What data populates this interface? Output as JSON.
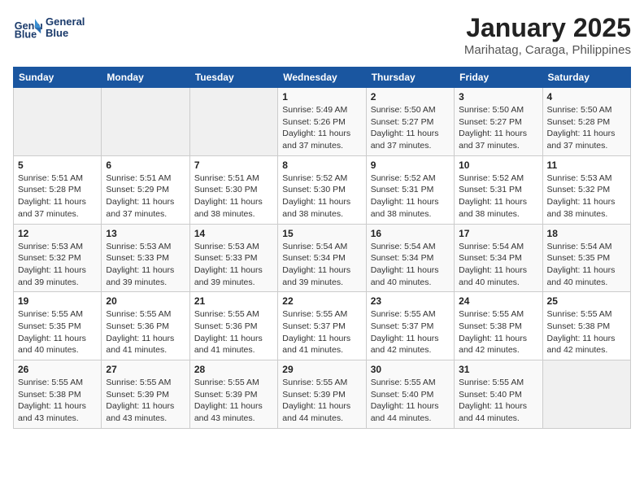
{
  "header": {
    "logo_line1": "General",
    "logo_line2": "Blue",
    "month": "January 2025",
    "location": "Marihatag, Caraga, Philippines"
  },
  "weekdays": [
    "Sunday",
    "Monday",
    "Tuesday",
    "Wednesday",
    "Thursday",
    "Friday",
    "Saturday"
  ],
  "weeks": [
    [
      {
        "day": "",
        "sunrise": "",
        "sunset": "",
        "daylight": "",
        "empty": true
      },
      {
        "day": "",
        "sunrise": "",
        "sunset": "",
        "daylight": "",
        "empty": true
      },
      {
        "day": "",
        "sunrise": "",
        "sunset": "",
        "daylight": "",
        "empty": true
      },
      {
        "day": "1",
        "sunrise": "Sunrise: 5:49 AM",
        "sunset": "Sunset: 5:26 PM",
        "daylight": "Daylight: 11 hours and 37 minutes."
      },
      {
        "day": "2",
        "sunrise": "Sunrise: 5:50 AM",
        "sunset": "Sunset: 5:27 PM",
        "daylight": "Daylight: 11 hours and 37 minutes."
      },
      {
        "day": "3",
        "sunrise": "Sunrise: 5:50 AM",
        "sunset": "Sunset: 5:27 PM",
        "daylight": "Daylight: 11 hours and 37 minutes."
      },
      {
        "day": "4",
        "sunrise": "Sunrise: 5:50 AM",
        "sunset": "Sunset: 5:28 PM",
        "daylight": "Daylight: 11 hours and 37 minutes."
      }
    ],
    [
      {
        "day": "5",
        "sunrise": "Sunrise: 5:51 AM",
        "sunset": "Sunset: 5:28 PM",
        "daylight": "Daylight: 11 hours and 37 minutes."
      },
      {
        "day": "6",
        "sunrise": "Sunrise: 5:51 AM",
        "sunset": "Sunset: 5:29 PM",
        "daylight": "Daylight: 11 hours and 37 minutes."
      },
      {
        "day": "7",
        "sunrise": "Sunrise: 5:51 AM",
        "sunset": "Sunset: 5:30 PM",
        "daylight": "Daylight: 11 hours and 38 minutes."
      },
      {
        "day": "8",
        "sunrise": "Sunrise: 5:52 AM",
        "sunset": "Sunset: 5:30 PM",
        "daylight": "Daylight: 11 hours and 38 minutes."
      },
      {
        "day": "9",
        "sunrise": "Sunrise: 5:52 AM",
        "sunset": "Sunset: 5:31 PM",
        "daylight": "Daylight: 11 hours and 38 minutes."
      },
      {
        "day": "10",
        "sunrise": "Sunrise: 5:52 AM",
        "sunset": "Sunset: 5:31 PM",
        "daylight": "Daylight: 11 hours and 38 minutes."
      },
      {
        "day": "11",
        "sunrise": "Sunrise: 5:53 AM",
        "sunset": "Sunset: 5:32 PM",
        "daylight": "Daylight: 11 hours and 38 minutes."
      }
    ],
    [
      {
        "day": "12",
        "sunrise": "Sunrise: 5:53 AM",
        "sunset": "Sunset: 5:32 PM",
        "daylight": "Daylight: 11 hours and 39 minutes."
      },
      {
        "day": "13",
        "sunrise": "Sunrise: 5:53 AM",
        "sunset": "Sunset: 5:33 PM",
        "daylight": "Daylight: 11 hours and 39 minutes."
      },
      {
        "day": "14",
        "sunrise": "Sunrise: 5:53 AM",
        "sunset": "Sunset: 5:33 PM",
        "daylight": "Daylight: 11 hours and 39 minutes."
      },
      {
        "day": "15",
        "sunrise": "Sunrise: 5:54 AM",
        "sunset": "Sunset: 5:34 PM",
        "daylight": "Daylight: 11 hours and 39 minutes."
      },
      {
        "day": "16",
        "sunrise": "Sunrise: 5:54 AM",
        "sunset": "Sunset: 5:34 PM",
        "daylight": "Daylight: 11 hours and 40 minutes."
      },
      {
        "day": "17",
        "sunrise": "Sunrise: 5:54 AM",
        "sunset": "Sunset: 5:34 PM",
        "daylight": "Daylight: 11 hours and 40 minutes."
      },
      {
        "day": "18",
        "sunrise": "Sunrise: 5:54 AM",
        "sunset": "Sunset: 5:35 PM",
        "daylight": "Daylight: 11 hours and 40 minutes."
      }
    ],
    [
      {
        "day": "19",
        "sunrise": "Sunrise: 5:55 AM",
        "sunset": "Sunset: 5:35 PM",
        "daylight": "Daylight: 11 hours and 40 minutes."
      },
      {
        "day": "20",
        "sunrise": "Sunrise: 5:55 AM",
        "sunset": "Sunset: 5:36 PM",
        "daylight": "Daylight: 11 hours and 41 minutes."
      },
      {
        "day": "21",
        "sunrise": "Sunrise: 5:55 AM",
        "sunset": "Sunset: 5:36 PM",
        "daylight": "Daylight: 11 hours and 41 minutes."
      },
      {
        "day": "22",
        "sunrise": "Sunrise: 5:55 AM",
        "sunset": "Sunset: 5:37 PM",
        "daylight": "Daylight: 11 hours and 41 minutes."
      },
      {
        "day": "23",
        "sunrise": "Sunrise: 5:55 AM",
        "sunset": "Sunset: 5:37 PM",
        "daylight": "Daylight: 11 hours and 42 minutes."
      },
      {
        "day": "24",
        "sunrise": "Sunrise: 5:55 AM",
        "sunset": "Sunset: 5:38 PM",
        "daylight": "Daylight: 11 hours and 42 minutes."
      },
      {
        "day": "25",
        "sunrise": "Sunrise: 5:55 AM",
        "sunset": "Sunset: 5:38 PM",
        "daylight": "Daylight: 11 hours and 42 minutes."
      }
    ],
    [
      {
        "day": "26",
        "sunrise": "Sunrise: 5:55 AM",
        "sunset": "Sunset: 5:38 PM",
        "daylight": "Daylight: 11 hours and 43 minutes."
      },
      {
        "day": "27",
        "sunrise": "Sunrise: 5:55 AM",
        "sunset": "Sunset: 5:39 PM",
        "daylight": "Daylight: 11 hours and 43 minutes."
      },
      {
        "day": "28",
        "sunrise": "Sunrise: 5:55 AM",
        "sunset": "Sunset: 5:39 PM",
        "daylight": "Daylight: 11 hours and 43 minutes."
      },
      {
        "day": "29",
        "sunrise": "Sunrise: 5:55 AM",
        "sunset": "Sunset: 5:39 PM",
        "daylight": "Daylight: 11 hours and 44 minutes."
      },
      {
        "day": "30",
        "sunrise": "Sunrise: 5:55 AM",
        "sunset": "Sunset: 5:40 PM",
        "daylight": "Daylight: 11 hours and 44 minutes."
      },
      {
        "day": "31",
        "sunrise": "Sunrise: 5:55 AM",
        "sunset": "Sunset: 5:40 PM",
        "daylight": "Daylight: 11 hours and 44 minutes."
      },
      {
        "day": "",
        "sunrise": "",
        "sunset": "",
        "daylight": "",
        "empty": true
      }
    ]
  ]
}
